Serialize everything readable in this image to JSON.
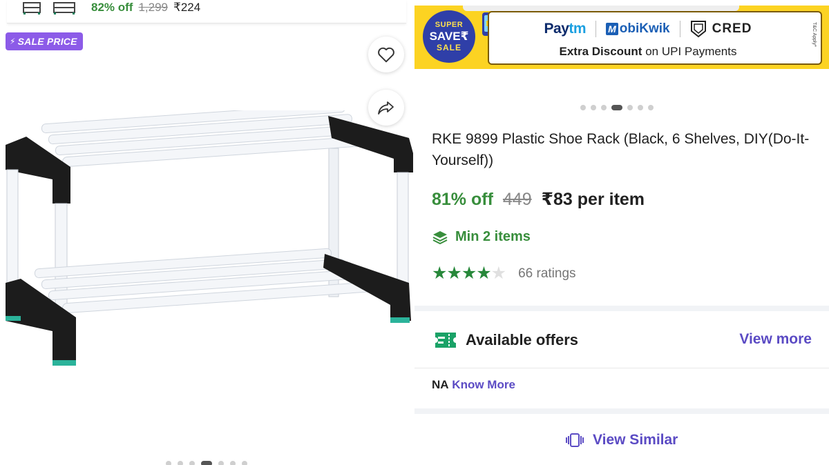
{
  "listing_top": {
    "discount": "82% off",
    "mrp": "1,299",
    "price": "₹224"
  },
  "badge": {
    "label": "SALE PRICE"
  },
  "banner": {
    "super_line1": "SUPER",
    "super_line2": "SAVE₹",
    "super_line3": "SALE",
    "logo_paytm": "Paytm",
    "logo_mobikwik": "MobiKwik",
    "logo_cred": "CRED",
    "offer_bold": "Extra Discount",
    "offer_rest": " on UPI Payments",
    "tnc": "T&C Apply*"
  },
  "carousel": {
    "count": 7,
    "active_index": 3
  },
  "product": {
    "title": "RKE 9899 Plastic Shoe Rack (Black, 6 Shelves, DIY(Do-It-Yourself))",
    "discount": "81% off",
    "mrp": "449",
    "price": "₹83 per item",
    "min_qty": "Min 2 items",
    "rating_stars": 4,
    "rating_max": 5,
    "ratings_count": "66 ratings"
  },
  "offers": {
    "title": "Available offers",
    "view_more": "View more",
    "na_label": "NA",
    "know_more": "Know More"
  },
  "footer": {
    "view_similar": "View Similar"
  },
  "icons": {
    "wishlist": "heart-icon",
    "share": "share-icon",
    "min_items": "layers-icon",
    "offers": "ticket-icon",
    "view_similar": "similar-cards-icon"
  },
  "colors": {
    "green": "#388e3c",
    "accent_purple": "#5b4bc4",
    "badge_purple": "#8c5be8",
    "banner_yellow": "#fcd322",
    "star_green": "#27883a"
  }
}
